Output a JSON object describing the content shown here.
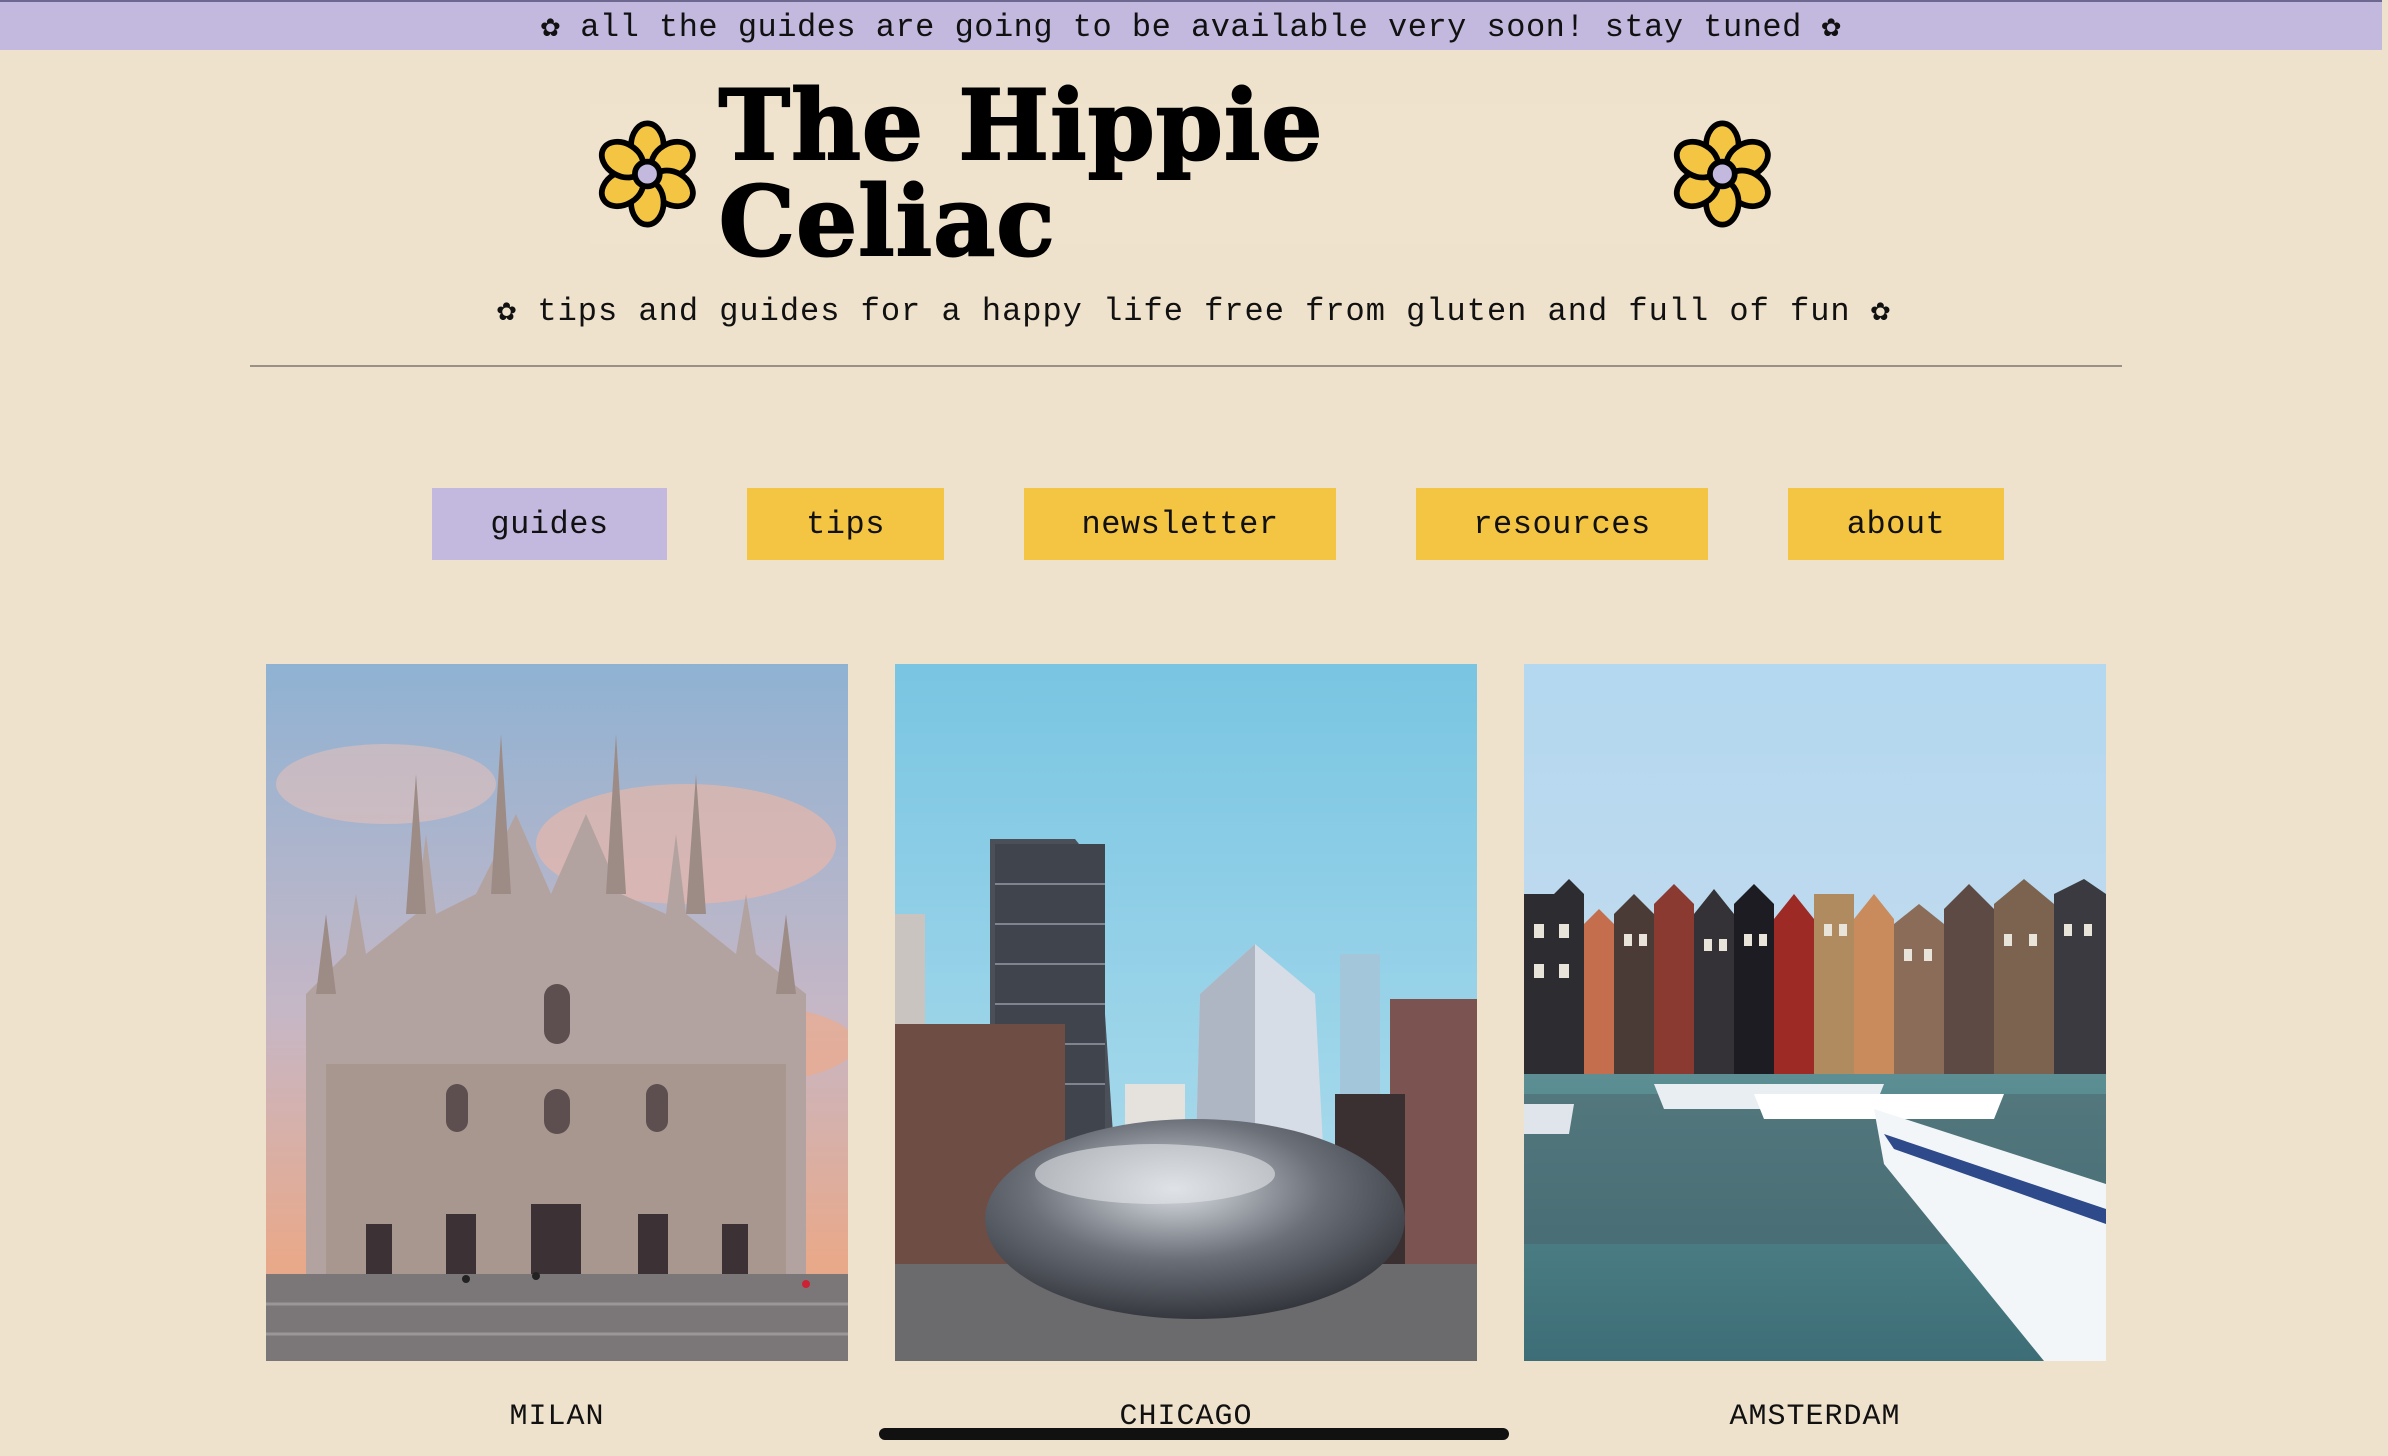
{
  "banner": {
    "text": "✿ all the guides are going to be available very soon! stay tuned ✿"
  },
  "header": {
    "title": "The Hippie Celiac",
    "tagline": "✿ tips and guides for a happy life free from gluten and full of fun ✿"
  },
  "nav": {
    "items": [
      {
        "label": "guides",
        "active": true
      },
      {
        "label": "tips",
        "active": false
      },
      {
        "label": "newsletter",
        "active": false
      },
      {
        "label": "resources",
        "active": false
      },
      {
        "label": "about",
        "active": false
      }
    ]
  },
  "guides": [
    {
      "city": "MILAN",
      "image": "milan-cathedral-photo"
    },
    {
      "city": "CHICAGO",
      "image": "chicago-cloud-gate-photo"
    },
    {
      "city": "AMSTERDAM",
      "image": "amsterdam-canal-houses-photo"
    }
  ],
  "colors": {
    "background": "#efe2cd",
    "banner": "#c3b8de",
    "button": "#f4c543",
    "button_active": "#c3b8de",
    "flower_petal": "#f4c543",
    "flower_center": "#c3b8de"
  }
}
